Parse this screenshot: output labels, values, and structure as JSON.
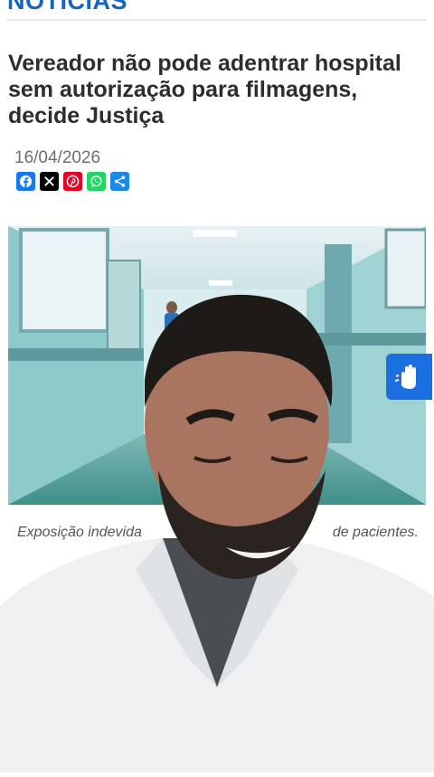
{
  "section": {
    "title": "NOTÍCIAS"
  },
  "article": {
    "headline": "Vereador não pode adentrar hospital sem autorização para filmagens, decide Justiça",
    "date": "16/04/2026",
    "caption_left": "Exposição indevida",
    "caption_right": "de pacientes."
  },
  "share": [
    {
      "name": "facebook",
      "icon": "facebook-icon",
      "color": "#1877f2"
    },
    {
      "name": "x",
      "icon": "x-icon",
      "color": "#000000"
    },
    {
      "name": "pinterest",
      "icon": "pinterest-icon",
      "color": "#e60023"
    },
    {
      "name": "whatsapp",
      "icon": "whatsapp-icon",
      "color": "#25d366"
    },
    {
      "name": "share",
      "icon": "share-icon",
      "color": "#1e88e5"
    }
  ],
  "accessibility": {
    "icon": "sign-language-hands-icon",
    "color": "#1b6fe0"
  },
  "colors": {
    "brand": "#1565c0",
    "headline": "#2d2d2d",
    "date": "#6e6e6e"
  }
}
